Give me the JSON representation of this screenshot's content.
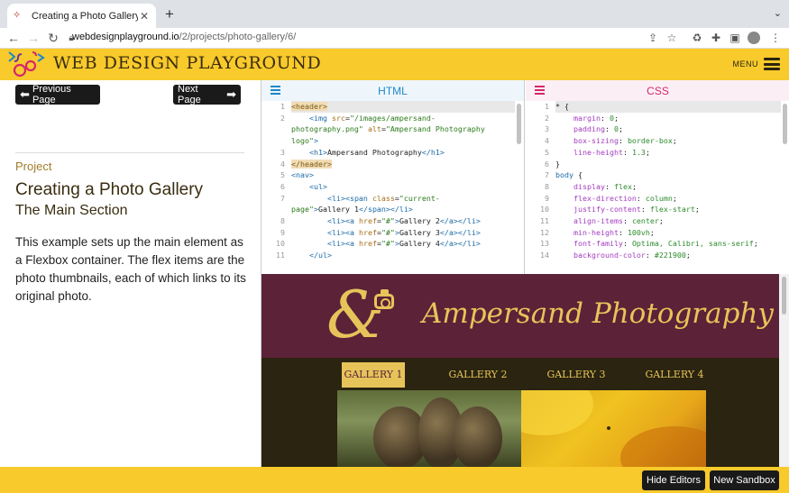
{
  "browser": {
    "tab_title": "Creating a Photo Gallery: The M",
    "url_host": "webdesignplayground.io",
    "url_path": "/2/projects/photo-gallery/6/"
  },
  "site": {
    "title": "WEB DESIGN PLAYGROUND",
    "menu_label": "MENU"
  },
  "nav": {
    "prev_label": "Previous Page",
    "next_label": "Next Page"
  },
  "lesson": {
    "eyebrow": "Project",
    "title": "Creating a Photo Gallery",
    "subtitle": "The Main Section",
    "description": "This example sets up the main element as a Flexbox container. The flex items are the photo thumbnails, each of which links to its original photo."
  },
  "editors": {
    "html_label": "HTML",
    "css_label": "CSS",
    "html_gutter": [
      "1",
      "2",
      "",
      "",
      "3",
      "4",
      "5",
      "6",
      "7",
      "",
      "8",
      "9",
      "10",
      "11"
    ],
    "css_gutter": [
      "1",
      "2",
      "3",
      "4",
      "5",
      "6",
      "7",
      "8",
      "9",
      "10",
      "11",
      "12",
      "13",
      "14"
    ]
  },
  "preview": {
    "site_title": "Ampersand Photography",
    "ampersand": "&",
    "nav": [
      "GALLERY 1",
      "GALLERY 2",
      "GALLERY 3",
      "GALLERY 4"
    ]
  },
  "footer": {
    "hide_editors": "Hide Editors",
    "new_sandbox": "New Sandbox"
  },
  "colors": {
    "site_yellow": "#f8ca2b",
    "preview_header": "#5c2238",
    "preview_gold": "#e7c45a",
    "html_accent": "#1e88c8",
    "css_accent": "#d4276c"
  }
}
